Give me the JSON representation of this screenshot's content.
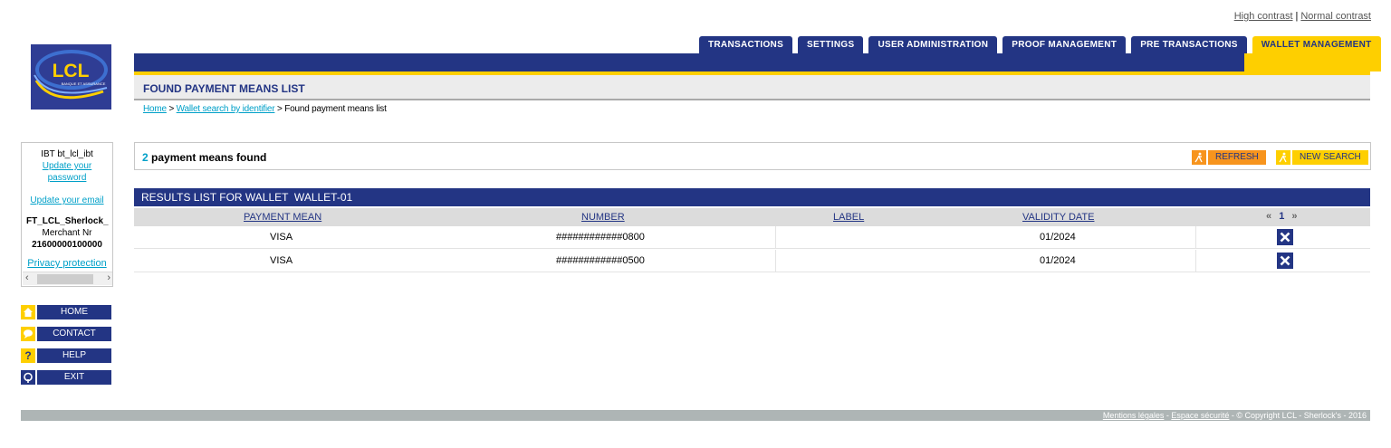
{
  "contrast": {
    "high": "High contrast",
    "sep": "|",
    "normal": "Normal contrast"
  },
  "logo": {
    "text": "LCL",
    "tagline": "BANQUE ET ASSURANCE"
  },
  "tabs": [
    {
      "label": "TRANSACTIONS",
      "active": false
    },
    {
      "label": "SETTINGS",
      "active": false
    },
    {
      "label": "USER ADMINISTRATION",
      "active": false
    },
    {
      "label": "PROOF MANAGEMENT",
      "active": false
    },
    {
      "label": "PRE TRANSACTIONS",
      "active": false
    },
    {
      "label": "WALLET MANAGEMENT",
      "active": true
    }
  ],
  "page": {
    "title": "FOUND PAYMENT MEANS LIST"
  },
  "breadcrumb": {
    "home": "Home",
    "sep1": " > ",
    "wallet_search": "Wallet search by identifier",
    "sep2": " > ",
    "current": "Found payment means list"
  },
  "user_panel": {
    "user": "IBT bt_lcl_ibt",
    "update_password_1": "Update your",
    "update_password_2": "password",
    "update_email": "Update your email",
    "shop": "FT_LCL_Sherlock_",
    "merchant_label": "Merchant Nr",
    "merchant_nr": "21600000100000",
    "privacy": "Privacy protection"
  },
  "nav": [
    {
      "label": "HOME",
      "icon": "home-icon"
    },
    {
      "label": "CONTACT",
      "icon": "chat-icon"
    },
    {
      "label": "HELP",
      "icon": "help-icon"
    },
    {
      "label": "EXIT",
      "icon": "exit-icon"
    }
  ],
  "found": {
    "count": "2",
    "text": " payment means found"
  },
  "actions": {
    "refresh": "REFRESH",
    "new_search": "NEW SEARCH"
  },
  "results": {
    "heading": "RESULTS LIST FOR WALLET  WALLET-01",
    "columns": {
      "payment_mean": "PAYMENT MEAN",
      "number": "NUMBER",
      "label": "LABEL",
      "validity": "VALIDITY DATE"
    },
    "pager": {
      "prev": "«",
      "page": "1",
      "next": "»"
    },
    "rows": [
      {
        "payment_mean": "VISA",
        "number": "############0800",
        "label": "",
        "validity": "01/2024"
      },
      {
        "payment_mean": "VISA",
        "number": "############0500",
        "label": "",
        "validity": "01/2024"
      }
    ]
  },
  "footer": {
    "legal": "Mentions légales",
    "sep1": " - ",
    "security": "Espace sécurité",
    "copyright": " - © Copyright LCL - Sherlock's - 2016"
  },
  "colors": {
    "brand_blue": "#233584",
    "brand_yellow": "#fecf00",
    "accent_orange": "#f7941d",
    "link": "#00a0c8"
  }
}
